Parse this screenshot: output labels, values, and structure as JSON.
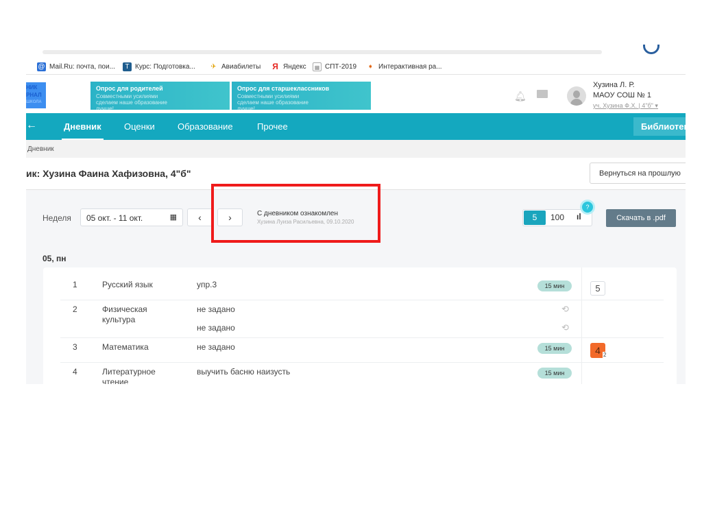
{
  "browser": {
    "bookmarks": [
      {
        "label": "Mail.Ru: почта, пои...",
        "icon": "at-icon"
      },
      {
        "label": "Курс: Подготовка...",
        "icon": "course-icon"
      },
      {
        "label": "Авиабилеты",
        "icon": "plane-icon"
      },
      {
        "label": "Яндекс",
        "icon": "yandex-icon"
      },
      {
        "label": "СПТ-2019",
        "icon": "chart-icon"
      },
      {
        "label": "Интерактивная ра...",
        "icon": "arrow-icon"
      }
    ]
  },
  "header": {
    "logo_lines": [
      "НИК",
      "РНАЛ",
      "ШКОЛА"
    ],
    "banners": [
      {
        "title": "Опрос для родителей",
        "text": "Совместными усилиями сделаем наше образование лучше!"
      },
      {
        "title": "Опрос для старшеклассников",
        "text": "Совместными усилиями сделаем наше образование лучше!"
      }
    ],
    "user": {
      "name": "Хузина Л. Р.",
      "school": "МАОУ СОШ № 1",
      "student": "уч. Хузина Ф.Х. | 4\"б\""
    }
  },
  "nav": {
    "items": [
      "Дневник",
      "Оценки",
      "Образование",
      "Прочее"
    ],
    "library": "Библиотека"
  },
  "breadcrumb": "Дневник",
  "page": {
    "title": "ик: Хузина Фаина Хафизовна, 4\"б\"",
    "back_button": "Вернуться на прошлую"
  },
  "controls": {
    "week_label": "Неделя",
    "week_value": "05 окт. - 11 окт.",
    "ack_title": "С дневником ознакомлен",
    "ack_by": "Хузина Луиза Расильевна, 09.10.2020",
    "scale_5": "5",
    "scale_100": "100",
    "help": "?",
    "download": "Скачать в .pdf"
  },
  "day": {
    "label": "05, пн",
    "lessons": [
      {
        "n": "1",
        "subject": "Русский язык",
        "hw": [
          "упр.3"
        ],
        "time": "15 мин",
        "grade": "5"
      },
      {
        "n": "2",
        "subject": "Физическая культура",
        "hw": [
          "не задано",
          "не задано"
        ]
      },
      {
        "n": "3",
        "subject": "Математика",
        "hw": [
          "не задано"
        ],
        "time": "15 мин",
        "grade": "4",
        "grade_weight": "2"
      },
      {
        "n": "4",
        "subject": "Литературное чтение",
        "hw": [
          "выучить басню наизусть"
        ],
        "time": "15 мин"
      }
    ]
  },
  "colors": {
    "nav": "#14a8bf",
    "accent": "#1aa5bd",
    "grade_bad": "#f26a2a",
    "highlight": "#ef1b1b"
  }
}
